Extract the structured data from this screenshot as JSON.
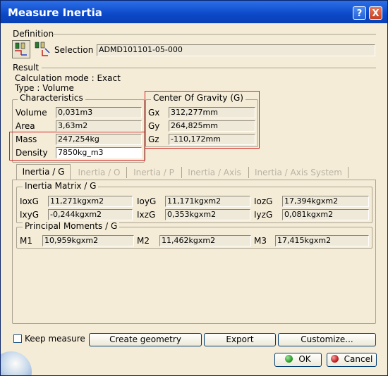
{
  "window": {
    "title": "Measure Inertia",
    "help_label": "?",
    "close_label": "X"
  },
  "definition": {
    "label": "Definition",
    "selection_label": "Selection :",
    "selection_value": "ADMD101101-05-000"
  },
  "result": {
    "label": "Result",
    "calc_mode": "Calculation mode :  Exact",
    "type": "Type :  Volume"
  },
  "characteristics": {
    "label": "Characteristics",
    "rows": [
      {
        "label": "Volume",
        "value": "0,031m3"
      },
      {
        "label": "Area",
        "value": "3,63m2"
      },
      {
        "label": "Mass",
        "value": "247,254kg"
      },
      {
        "label": "Density",
        "value": "7850kg_m3"
      }
    ]
  },
  "cog": {
    "label": "Center Of Gravity (G)",
    "rows": [
      {
        "label": "Gx",
        "value": "312,277mm"
      },
      {
        "label": "Gy",
        "value": "264,825mm"
      },
      {
        "label": "Gz",
        "value": "-110,172mm"
      }
    ]
  },
  "tabs": [
    {
      "label": "Inertia / G",
      "active": true
    },
    {
      "label": "Inertia / O",
      "active": false
    },
    {
      "label": "Inertia / P",
      "active": false
    },
    {
      "label": "Inertia / Axis",
      "active": false
    },
    {
      "label": "Inertia / Axis System",
      "active": false
    }
  ],
  "inertia_matrix": {
    "label": "Inertia Matrix / G",
    "row1": [
      {
        "label": "IoxG",
        "value": "11,271kgxm2"
      },
      {
        "label": "IoyG",
        "value": "11,171kgxm2"
      },
      {
        "label": "IozG",
        "value": "17,394kgxm2"
      }
    ],
    "row2": [
      {
        "label": "IxyG",
        "value": "-0,244kgxm2"
      },
      {
        "label": "IxzG",
        "value": "0,353kgxm2"
      },
      {
        "label": "IyzG",
        "value": "0,081kgxm2"
      }
    ]
  },
  "principal_moments": {
    "label": "Principal Moments / G",
    "row": [
      {
        "label": "M1",
        "value": "10,959kgxm2"
      },
      {
        "label": "M2",
        "value": "11,462kgxm2"
      },
      {
        "label": "M3",
        "value": "17,415kgxm2"
      }
    ]
  },
  "bottom": {
    "keep_measure": "Keep measure",
    "create_geometry": "Create geometry",
    "export": "Export",
    "customize": "Customize...",
    "ok": "OK",
    "cancel": "Cancel"
  },
  "colors": {
    "highlight_box": "#d42020",
    "ok_icon": "#2aa12a",
    "cancel_icon": "#c42020"
  }
}
